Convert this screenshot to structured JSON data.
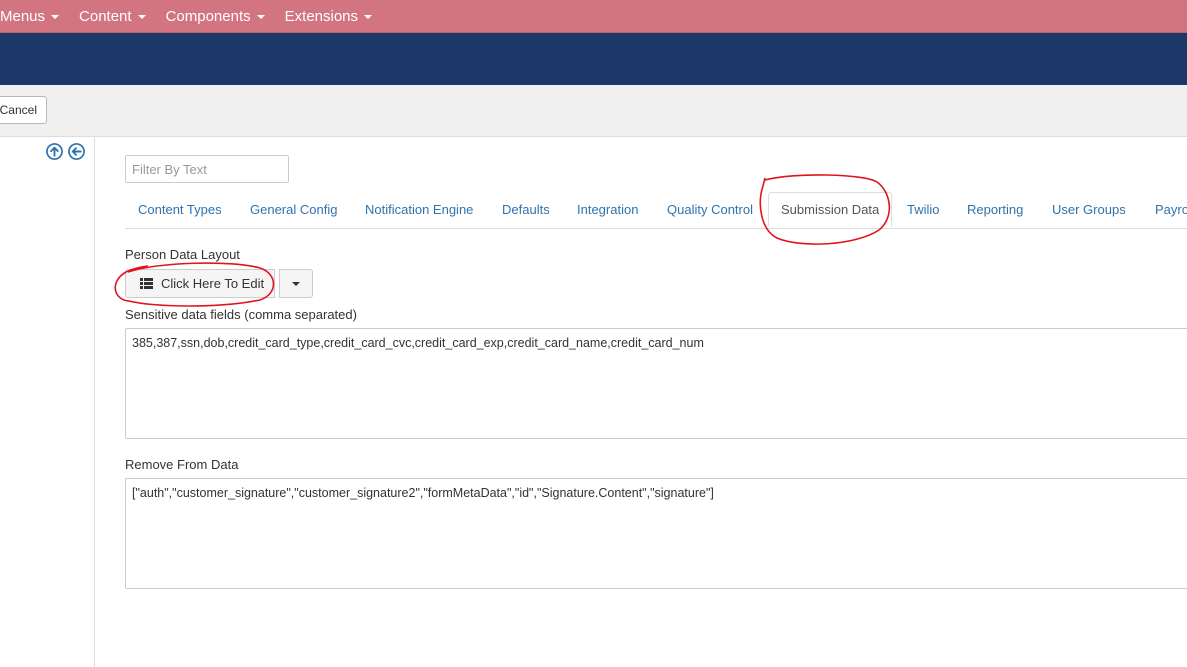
{
  "topnav": {
    "items": [
      {
        "label": "Menus"
      },
      {
        "label": "Content"
      },
      {
        "label": "Components"
      },
      {
        "label": "Extensions"
      }
    ]
  },
  "toolbar": {
    "cancel_label": "Cancel"
  },
  "sidebar": {
    "icons": [
      "arrow-up-circle-icon",
      "arrow-left-circle-icon"
    ]
  },
  "filter": {
    "placeholder": "Filter By Text",
    "value": ""
  },
  "tabs": [
    {
      "label": "Content Types"
    },
    {
      "label": "General Config"
    },
    {
      "label": "Notification Engine"
    },
    {
      "label": "Defaults"
    },
    {
      "label": "Integration"
    },
    {
      "label": "Quality Control"
    },
    {
      "label": "Submission Data",
      "active": true
    },
    {
      "label": "Twilio"
    },
    {
      "label": "Reporting"
    },
    {
      "label": "User Groups"
    },
    {
      "label": "Payro"
    }
  ],
  "person_data_layout": {
    "label": "Person Data Layout",
    "edit_button_label": "Click Here To Edit"
  },
  "sensitive_fields": {
    "label": "Sensitive data fields (comma separated)",
    "value": "385,387,ssn,dob,credit_card_type,credit_card_cvc,credit_card_exp,credit_card_name,credit_card_num"
  },
  "remove_from_data": {
    "label": "Remove From Data",
    "value": "[\"auth\",\"customer_signature\",\"customer_signature2\",\"formMetaData\",\"id\",\"Signature.Content\",\"signature\"]"
  },
  "colors": {
    "topnav_bg": "#d37580",
    "header_bg": "#1c3869",
    "link": "#2f73ad",
    "annotation": "#e0141e"
  }
}
